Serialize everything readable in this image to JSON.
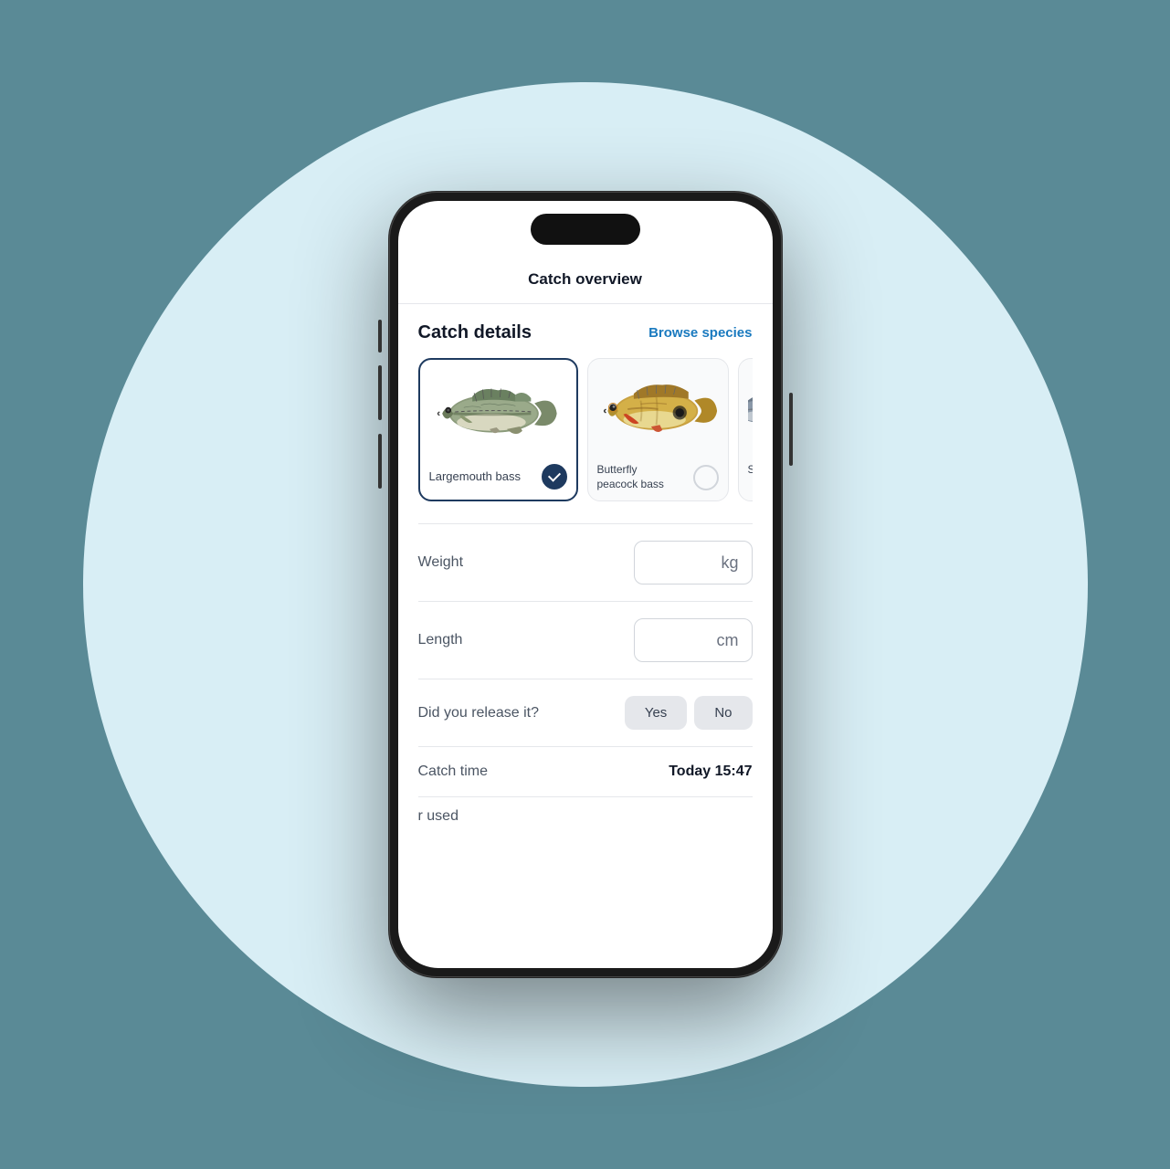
{
  "header": {
    "title": "Catch overview"
  },
  "catch_details": {
    "section_title": "Catch details",
    "browse_link": "Browse species",
    "fish_cards": [
      {
        "id": "largemouth-bass",
        "name": "Largemouth bass",
        "selected": true
      },
      {
        "id": "butterfly-peacock-bass",
        "name": "Butterfly\npeacock bass",
        "selected": false
      },
      {
        "id": "spotted-bass",
        "name": "Spotte...",
        "selected": false
      }
    ]
  },
  "form": {
    "weight": {
      "label": "Weight",
      "unit": "kg",
      "value": ""
    },
    "length": {
      "label": "Length",
      "unit": "cm",
      "value": ""
    },
    "release": {
      "label": "Did you release it?",
      "yes_label": "Yes",
      "no_label": "No"
    },
    "catch_time": {
      "label": "Catch time",
      "value": "Today 15:47"
    },
    "gear_used": {
      "label": "r used"
    }
  }
}
